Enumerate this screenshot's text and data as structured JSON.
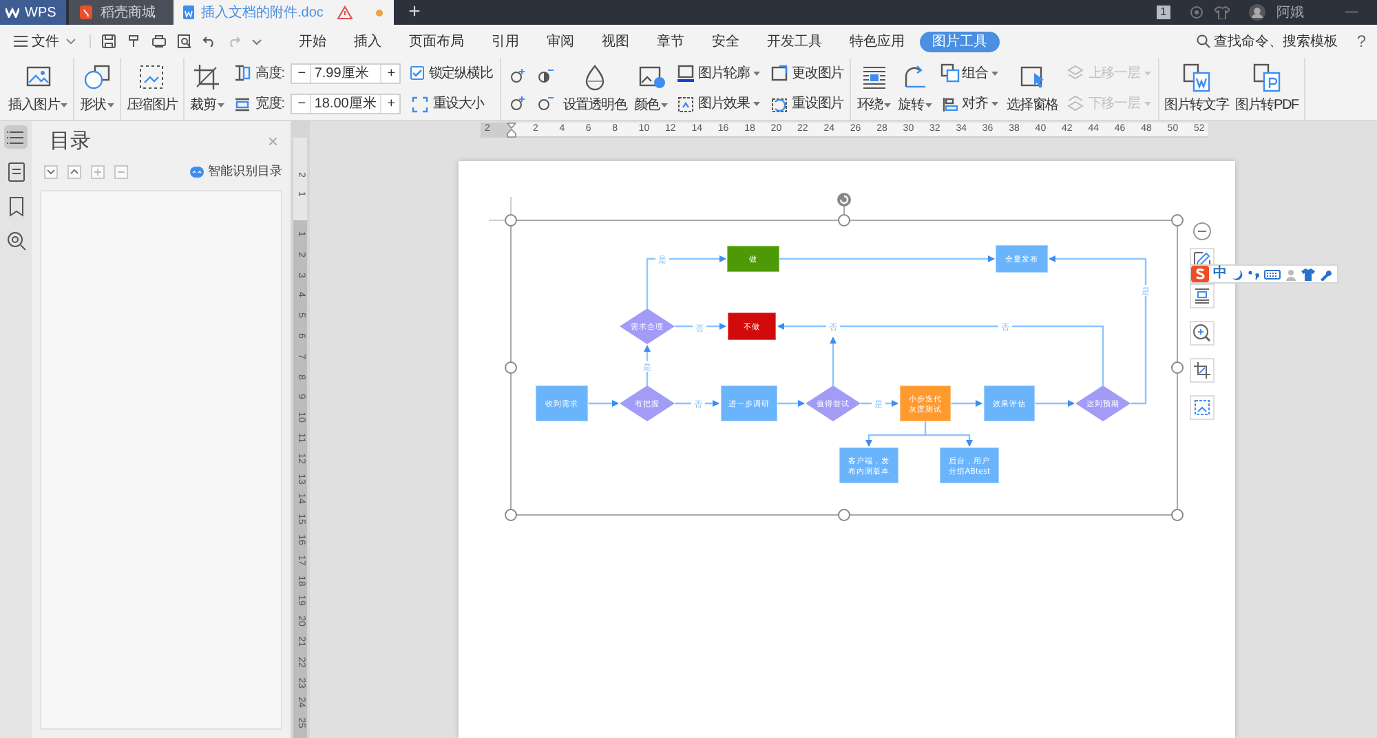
{
  "title_bar": {
    "tabs": [
      {
        "label": "WPS",
        "kind": "home",
        "selected": false
      },
      {
        "label": "稻壳商城",
        "kind": "store",
        "selected": false
      },
      {
        "label": "插入文档的附件.doc",
        "kind": "doc",
        "selected": true
      }
    ],
    "new_tab": "+",
    "badge": "1",
    "user": "阿娥",
    "minimize": "—"
  },
  "menu": {
    "file": "文件",
    "tabs": [
      {
        "label": "开始",
        "selected": false
      },
      {
        "label": "插入",
        "selected": false
      },
      {
        "label": "页面布局",
        "selected": false
      },
      {
        "label": "引用",
        "selected": false
      },
      {
        "label": "审阅",
        "selected": false
      },
      {
        "label": "视图",
        "selected": false
      },
      {
        "label": "章节",
        "selected": false
      },
      {
        "label": "安全",
        "selected": false
      },
      {
        "label": "开发工具",
        "selected": false
      },
      {
        "label": "特色应用",
        "selected": false
      },
      {
        "label": "图片工具",
        "selected": true
      }
    ],
    "search": "查找命令、搜索模板",
    "help": "?"
  },
  "ribbon": {
    "groups": [
      [
        {
          "kind": "big",
          "label": "插入图片",
          "dropdown": true
        }
      ],
      [
        {
          "kind": "big",
          "label": "形状",
          "dropdown": true
        }
      ],
      [
        {
          "kind": "big",
          "label": "压缩图片",
          "dropdown": false
        }
      ],
      [
        {
          "kind": "big",
          "label": "裁剪",
          "dropdown": true
        },
        {
          "kind": "stack",
          "rows": [
            {
              "kind": "field",
              "label": "高度:",
              "value": "7.99厘米",
              "minus": "−",
              "plus": "+"
            },
            {
              "kind": "field",
              "label": "宽度:",
              "value": "18.00厘米",
              "minus": "−",
              "plus": "+"
            }
          ]
        },
        {
          "kind": "stack",
          "rows": [
            {
              "kind": "check",
              "label": "锁定纵横比",
              "checked": true
            },
            {
              "kind": "small",
              "label": "重设大小",
              "dropdown": false
            }
          ]
        }
      ],
      [
        {
          "kind": "adjust"
        },
        {
          "kind": "big",
          "label": "设置透明色",
          "dropdown": false
        },
        {
          "kind": "big",
          "label": "颜色",
          "dropdown": true
        },
        {
          "kind": "stack",
          "rows": [
            {
              "kind": "small",
              "label": "图片轮廓",
              "dropdown": true
            },
            {
              "kind": "small",
              "label": "图片效果",
              "dropdown": true
            }
          ]
        },
        {
          "kind": "stack",
          "rows": [
            {
              "kind": "small",
              "label": "更改图片",
              "dropdown": false
            },
            {
              "kind": "small",
              "label": "重设图片",
              "dropdown": false
            }
          ]
        }
      ],
      [
        {
          "kind": "big",
          "label": "环绕",
          "dropdown": true
        },
        {
          "kind": "big",
          "label": "旋转",
          "dropdown": true
        },
        {
          "kind": "stack",
          "rows": [
            {
              "kind": "small",
              "label": "组合",
              "dropdown": true
            },
            {
              "kind": "small",
              "label": "对齐",
              "dropdown": true
            }
          ]
        },
        {
          "kind": "big",
          "label": "选择窗格",
          "dropdown": false
        },
        {
          "kind": "stack",
          "rows": [
            {
              "kind": "small",
              "label": "上移一层",
              "dropdown": true,
              "disabled": true
            },
            {
              "kind": "small",
              "label": "下移一层",
              "dropdown": true,
              "disabled": true
            }
          ]
        }
      ],
      [
        {
          "kind": "big",
          "label": "图片转文字",
          "dropdown": false
        },
        {
          "kind": "big",
          "label": "图片转PDF",
          "dropdown": false
        }
      ]
    ]
  },
  "nav_strip": [
    {
      "selected": true
    },
    {
      "selected": false
    },
    {
      "selected": false
    },
    {
      "selected": false
    }
  ],
  "sidebar": {
    "title": "目录",
    "close": "×",
    "smart_toc": "智能识别目录"
  },
  "rulers": {
    "horizontal": [
      "2",
      "2",
      "4",
      "6",
      "8",
      "10",
      "12",
      "14",
      "16",
      "18",
      "20",
      "22",
      "24",
      "26",
      "28",
      "30",
      "32",
      "34",
      "36",
      "38",
      "40",
      "42",
      "44",
      "46",
      "48",
      "50",
      "52"
    ],
    "vertical": [
      "2",
      "1",
      "1",
      "2",
      "3",
      "4",
      "5",
      "6",
      "7",
      "8",
      "9",
      "10",
      "11",
      "12",
      "13",
      "14",
      "15",
      "16",
      "17",
      "18",
      "19",
      "20",
      "21",
      "22",
      "23",
      "24",
      "25"
    ]
  },
  "flowchart": {
    "nodes": [
      {
        "kind": "box",
        "lines": [
          "做"
        ],
        "color": "#4e9a06"
      },
      {
        "kind": "box",
        "lines": [
          "全量发布"
        ],
        "color": "#6ab4fc"
      },
      {
        "kind": "diamond",
        "lines": [
          "需求合理"
        ],
        "color": "#a29cf6"
      },
      {
        "kind": "box",
        "lines": [
          "不做"
        ],
        "color": "#d20a0a"
      },
      {
        "kind": "box",
        "lines": [
          "收到需求"
        ],
        "color": "#6ab4fc"
      },
      {
        "kind": "diamond",
        "lines": [
          "有把握"
        ],
        "color": "#a29cf6"
      },
      {
        "kind": "box",
        "lines": [
          "进一步调研"
        ],
        "color": "#6ab4fc"
      },
      {
        "kind": "diamond",
        "lines": [
          "值得尝试"
        ],
        "color": "#a29cf6"
      },
      {
        "kind": "box",
        "lines": [
          "小步迭代",
          "灰度测试"
        ],
        "color": "#ff9a2e"
      },
      {
        "kind": "box",
        "lines": [
          "效果评估"
        ],
        "color": "#6ab4fc"
      },
      {
        "kind": "diamond",
        "lines": [
          "达到预期"
        ],
        "color": "#a29cf6"
      },
      {
        "kind": "box",
        "lines": [
          "客户端，发",
          "布内测版本"
        ],
        "color": "#6ab4fc"
      },
      {
        "kind": "box",
        "lines": [
          "后台，用户",
          "分组ABtest"
        ],
        "color": "#6ab4fc"
      }
    ],
    "edge_labels": [
      "是",
      "是",
      "否",
      "否",
      "否",
      "是",
      "否",
      "是"
    ]
  },
  "ime_bar": {
    "mode": "中"
  }
}
